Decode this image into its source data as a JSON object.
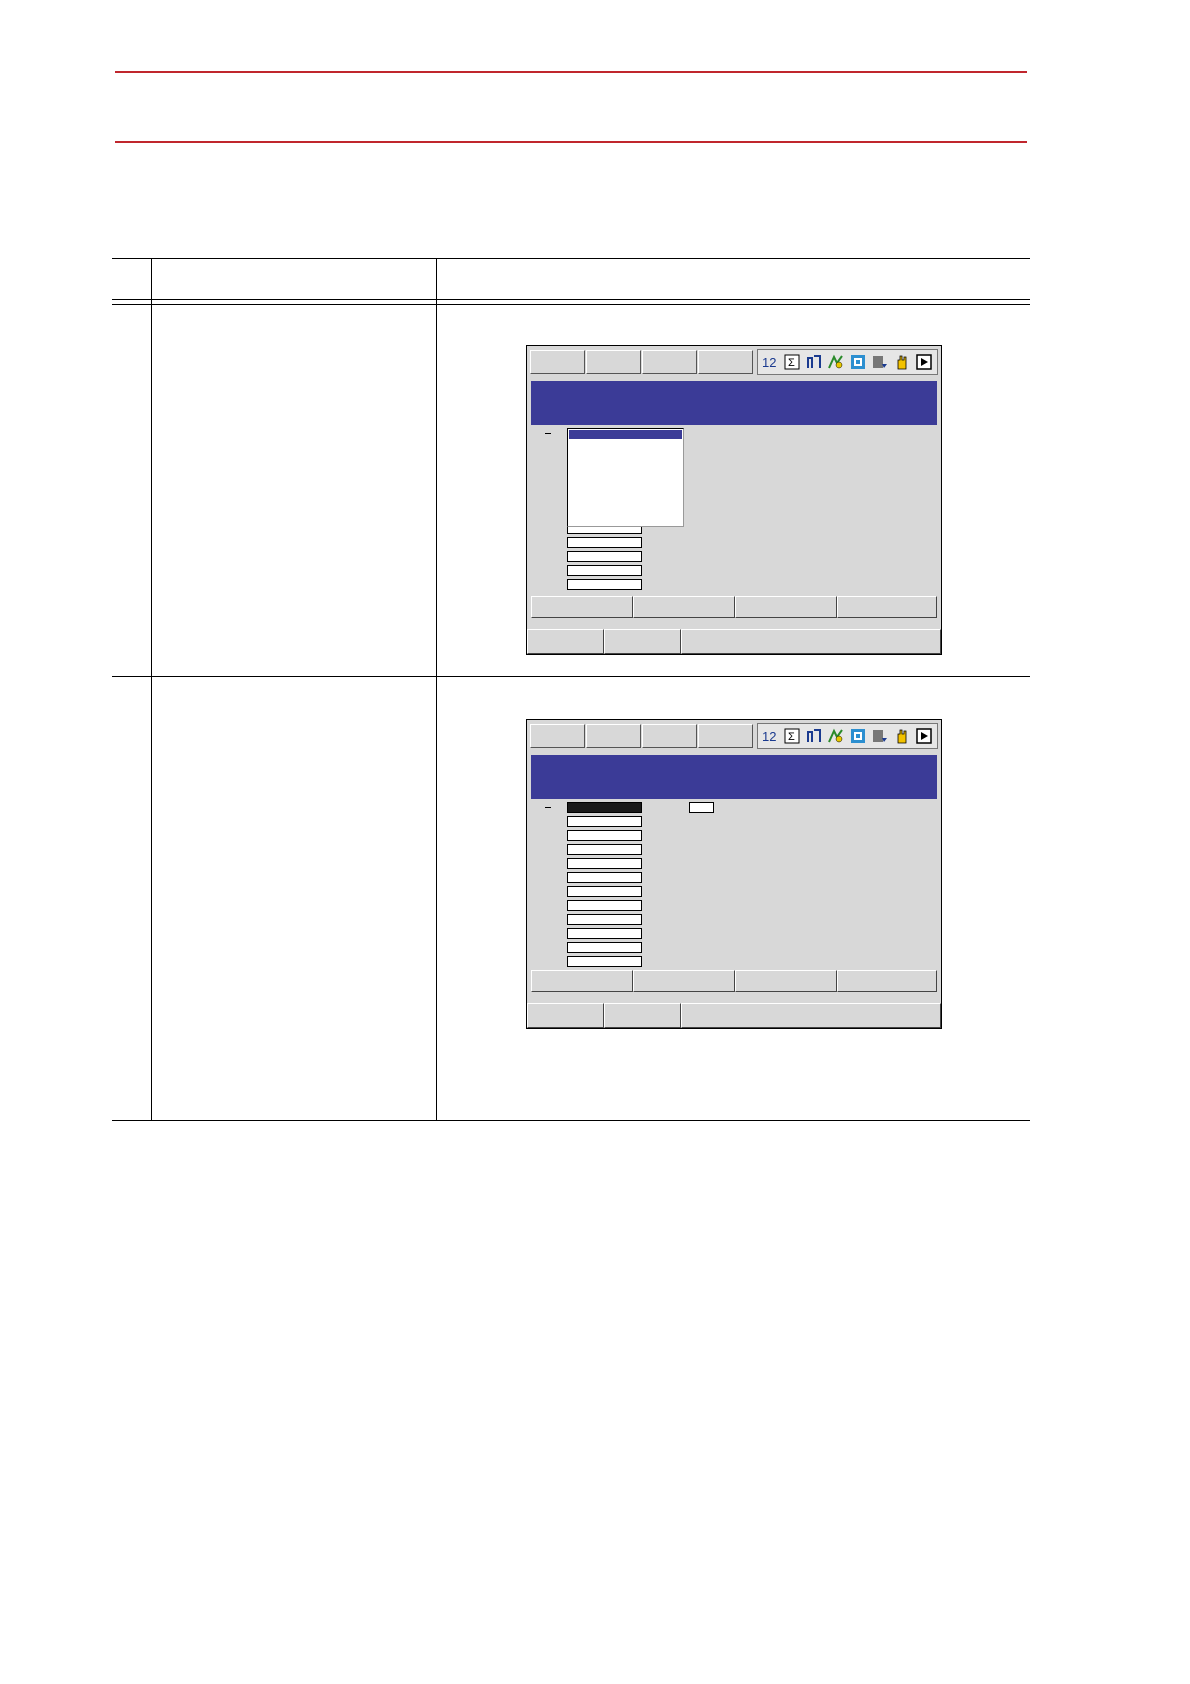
{
  "header": {
    "title": ""
  },
  "table": {
    "columns": [
      "",
      "",
      ""
    ],
    "rows": [
      {
        "step": "",
        "operation": "",
        "explanation": ""
      },
      {
        "step": "",
        "operation": "",
        "explanation": ""
      }
    ]
  },
  "screen": {
    "title": "",
    "icons": [
      "page-number-icon",
      "sigma-icon",
      "edit-mode-icon",
      "jog-icon",
      "storage-icon",
      "cycle-icon",
      "hand-icon",
      "play-icon"
    ],
    "colors": {
      "title_bar": "#3b3b97",
      "panel": "#d8d8d8",
      "header_rule": "#c0262d"
    }
  }
}
